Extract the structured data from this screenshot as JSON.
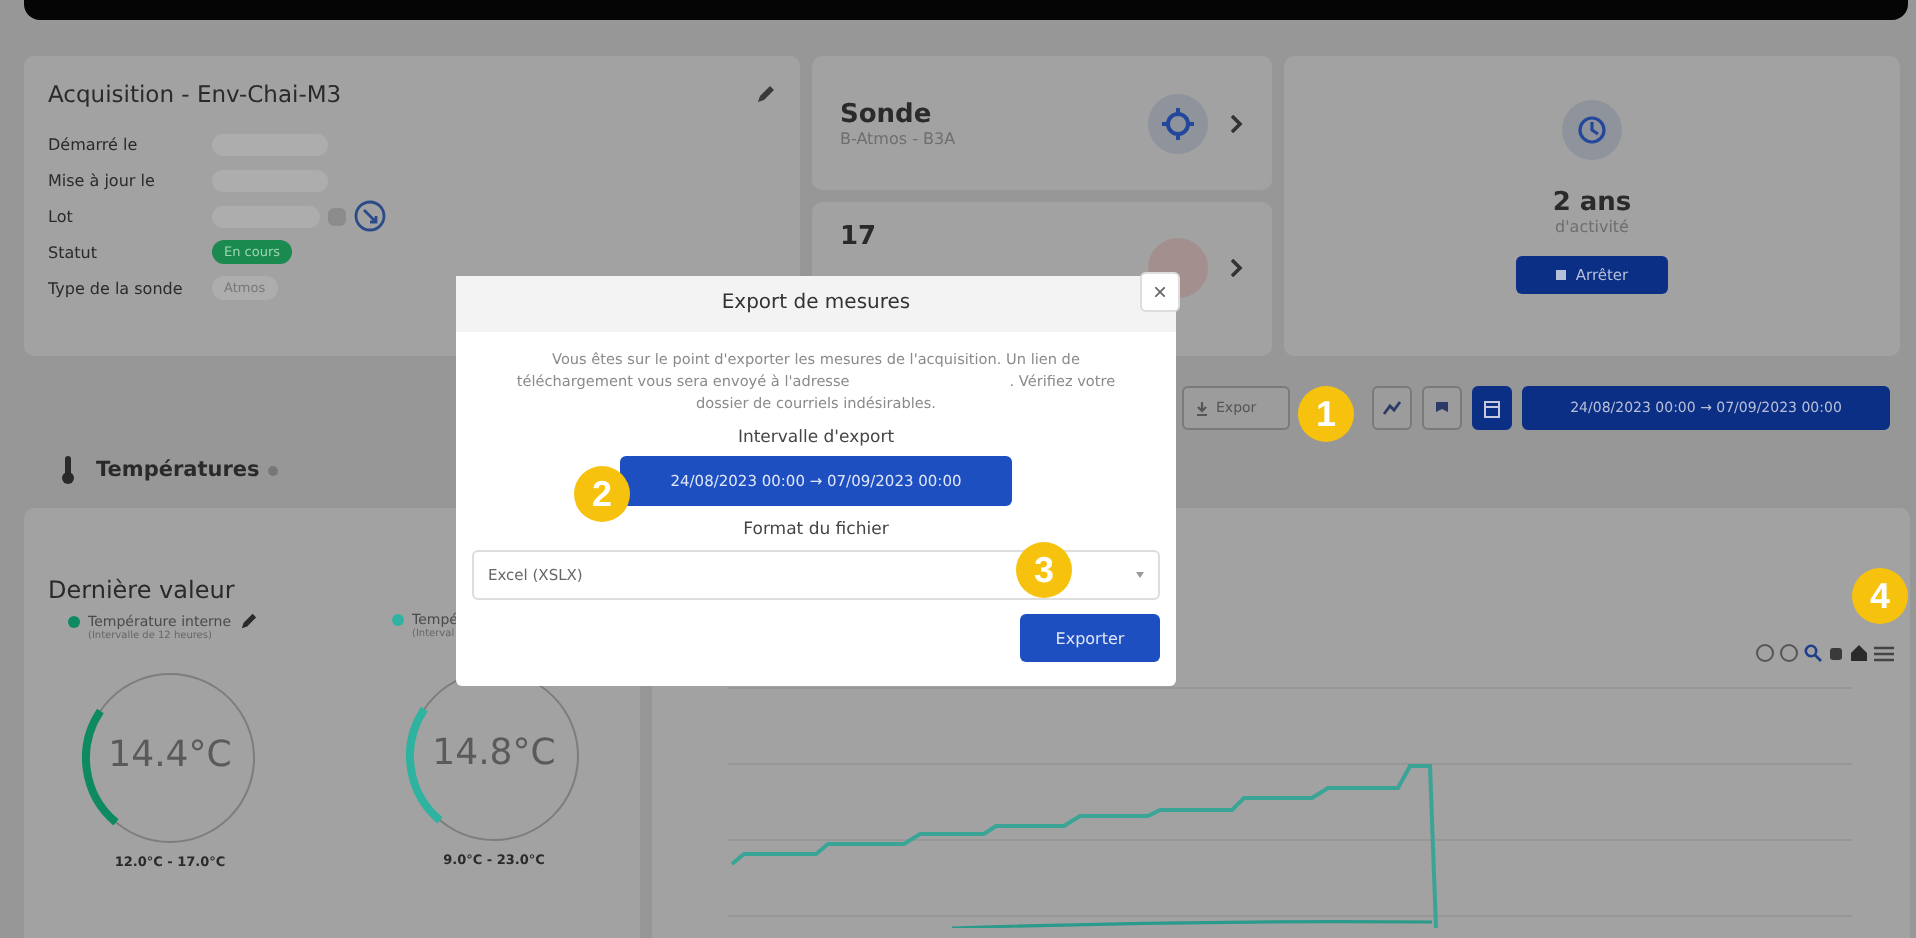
{
  "acquisition": {
    "title": "Acquisition - Env-Chai-M3",
    "fields": [
      {
        "label": "Démarré le",
        "kind": "blurred"
      },
      {
        "label": "Mise à jour le",
        "kind": "blurred"
      },
      {
        "label": "Lot",
        "kind": "lot"
      },
      {
        "label": "Statut",
        "kind": "status",
        "value": "En cours"
      },
      {
        "label": "Type de la sonde",
        "kind": "tag",
        "value": "Atmos"
      }
    ]
  },
  "probe_card": {
    "title": "Sonde",
    "subtitle": "B-Atmos - B3A"
  },
  "count_card": {
    "title": "17"
  },
  "duration_card": {
    "value": "2 ans",
    "caption": "d'activité",
    "button": "Arrêter"
  },
  "toolbar": {
    "export_button": "Expor",
    "date_range": "24/08/2023 00:00 → 07/09/2023 00:00"
  },
  "section": {
    "title": "Températures"
  },
  "last_value": {
    "title": "Dernière valeur",
    "gauges": [
      {
        "name": "Température interne",
        "interval": "(Intervalle de 12 heures)",
        "reading": "14.4°C",
        "range": "12.0°C - 17.0°C",
        "color": "#0e8a63",
        "editable": true
      },
      {
        "name": "Tempé",
        "interval": "(Interval",
        "reading": "14.8°C",
        "range": "9.0°C - 23.0°C",
        "color": "#2fb3a0",
        "editable": false
      }
    ]
  },
  "dialog": {
    "title": "Export de mesures",
    "close": "×",
    "message_start": "Vous êtes sur le point d'exporter les mesures de l'acquisition. Un lien de téléchargement vous sera envoyé à l'adresse",
    "message_end": ". Vérifiez votre dossier de courriels indésirables.",
    "interval_label": "Intervalle d'export",
    "interval_value": "24/08/2023 00:00 → 07/09/2023 00:00",
    "format_label": "Format du fichier",
    "format_value": "Excel (XSLX)",
    "submit": "Exporter"
  },
  "markers": [
    "1",
    "2",
    "3",
    "4"
  ]
}
